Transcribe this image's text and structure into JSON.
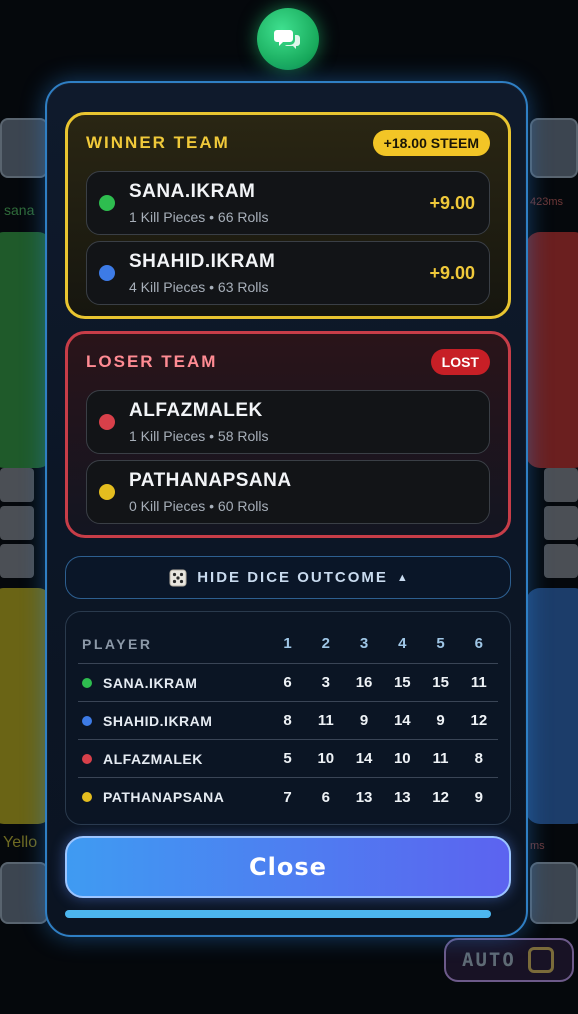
{
  "background": {
    "player_left_name": "sana",
    "player_right_ping": "423ms",
    "player_bottom_left_label": "Yello",
    "player_bottom_right_label": "ms",
    "auto_button": {
      "label": "AUTO"
    }
  },
  "chat_button": {
    "icon": "chat-bubbles-icon"
  },
  "winner_team": {
    "title": "WINNER TEAM",
    "reward_badge": "+18.00 STEEM",
    "players": [
      {
        "name": "SANA.IKRAM",
        "stats": "1 Kill Pieces • 66 Rolls",
        "score": "+9.00",
        "color": "#2ebd4f"
      },
      {
        "name": "SHAHID.IKRAM",
        "stats": "4 Kill Pieces • 63 Rolls",
        "score": "+9.00",
        "color": "#3d7be6"
      }
    ]
  },
  "loser_team": {
    "title": "LOSER TEAM",
    "status_badge": "LOST",
    "players": [
      {
        "name": "ALFAZMALEK",
        "stats": "1 Kill Pieces • 58 Rolls",
        "color": "#d8404a"
      },
      {
        "name": "PATHANAPSANA",
        "stats": "0 Kill Pieces • 60 Rolls",
        "color": "#e4bd1f"
      }
    ]
  },
  "dice_toggle": {
    "label": "HIDE DICE OUTCOME",
    "arrow": "▲",
    "icon": "dice-icon"
  },
  "dice_table": {
    "header_label": "PLAYER",
    "columns": [
      "1",
      "2",
      "3",
      "4",
      "5",
      "6"
    ],
    "rows": [
      {
        "name": "SANA.IKRAM",
        "color": "#2ebd4f",
        "values": [
          "6",
          "3",
          "16",
          "15",
          "15",
          "11"
        ]
      },
      {
        "name": "SHAHID.IKRAM",
        "color": "#3d7be6",
        "values": [
          "8",
          "11",
          "9",
          "14",
          "9",
          "12"
        ]
      },
      {
        "name": "ALFAZMALEK",
        "color": "#d8404a",
        "values": [
          "5",
          "10",
          "14",
          "10",
          "11",
          "8"
        ]
      },
      {
        "name": "PATHANAPSANA",
        "color": "#e4bd1f",
        "values": [
          "7",
          "6",
          "13",
          "13",
          "12",
          "9"
        ]
      }
    ]
  },
  "close_button": {
    "label": "Close"
  },
  "progress": {
    "fraction": 1.0
  },
  "colors": {
    "accent_gold": "#f0c93a",
    "accent_red": "#c73d48",
    "modal_border": "#2f7fc4",
    "close_gradient_start": "#3f9bf2",
    "close_gradient_end": "#5c63f0"
  }
}
